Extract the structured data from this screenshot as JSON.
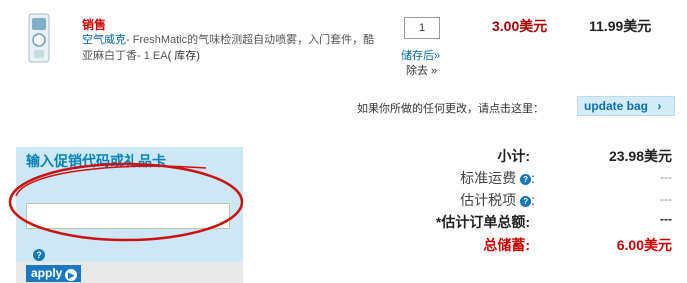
{
  "item": {
    "badge": "销售",
    "name_brand": "空气威克",
    "name_rest": "- FreshMatic的气味检测超自动喷雾，入门套件，酷亚麻白丁香- 1 EA",
    "stock": "( 库存)",
    "quantity": "1",
    "save_for_later": "储存后»",
    "remove": "除去 »",
    "unit_price": "3.00美元",
    "line_total": "11.99美元"
  },
  "update": {
    "hint": "如果你所做的任何更改，请点击这里：",
    "button": "update bag",
    "button_icon": "chevron-right-icon"
  },
  "promo": {
    "title": "输入促销代码或礼品卡",
    "input_value": "",
    "apply_label": "apply"
  },
  "totals": {
    "subtotal_label": "小计:",
    "subtotal_value": "23.98美元",
    "shipping_label": "标准运费",
    "shipping_value": "---",
    "tax_label": "估计税项",
    "tax_value": "---",
    "estimated_label": "*估计订单总额:",
    "estimated_value": "---",
    "savings_label": "总储蓄:",
    "savings_value": "6.00美元"
  },
  "colors": {
    "sale_red": "#cc0000",
    "link_blue": "#0066aa",
    "promo_bg": "#cde8f4",
    "annotation_red": "#cc1111"
  }
}
